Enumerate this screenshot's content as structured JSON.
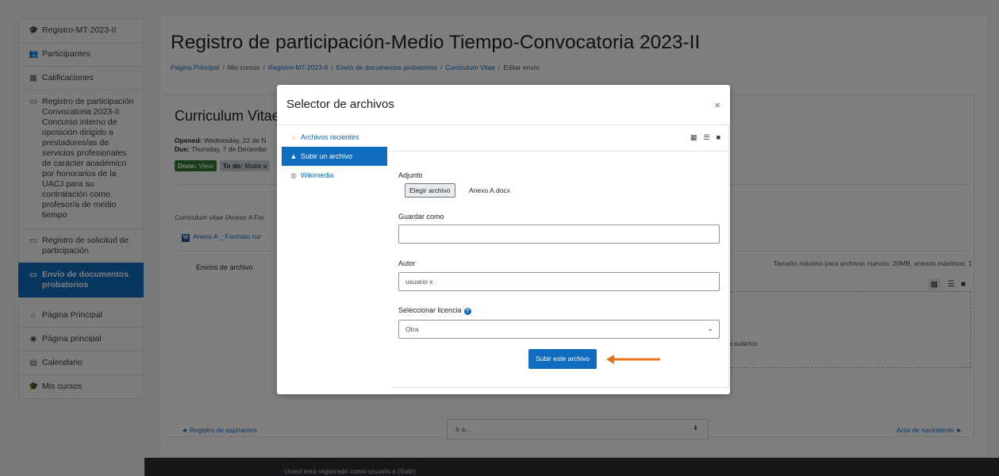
{
  "sidebar": {
    "items": [
      {
        "label": "Registro-MT-2023-II",
        "icon": "graduation-cap-icon"
      },
      {
        "label": "Participantes",
        "icon": "users-icon"
      },
      {
        "label": "Calificaciones",
        "icon": "table-icon"
      },
      {
        "label": "Registro de participación Convocatoria 2023-II Concurso interno de oposición dirigido a prestadores/as de servicios profesionales de carácter académico por honorarios de la UACJ para su contratación como profesor/a de medio tiempo",
        "icon": "folder-icon"
      },
      {
        "label": "Registro de solicitud de participación",
        "icon": "folder-icon"
      },
      {
        "label": "Envío de documentos probatorios",
        "icon": "folder-icon",
        "active": true
      },
      {
        "label": "Página Principal",
        "icon": "home-icon"
      },
      {
        "label": "Página principal",
        "icon": "dashboard-icon"
      },
      {
        "label": "Calendario",
        "icon": "calendar-icon"
      },
      {
        "label": "Mis cursos",
        "icon": "graduation-cap-icon"
      }
    ]
  },
  "header": {
    "title": "Registro de participación-Medio Tiempo-Convocatoria 2023-II",
    "breadcrumb": [
      "Página Principal",
      "Mis cursos",
      "Registro-MT-2023-II",
      "Envío de documentos probatorios",
      "Curriculum Vitae",
      "Editar envío"
    ]
  },
  "assignment": {
    "title": "Curriculum Vitae",
    "opened_label": "Opened:",
    "opened_value": "Wednesday, 22 de N",
    "due_label": "Due:",
    "due_value": "Thursday, 7 de Decembe",
    "done_label": "Done:",
    "done_value": "View",
    "todo_label": "To do:",
    "todo_value": "Make a",
    "intro": "Curriculum vitae (Anexo A For",
    "file_link": "Anexo A _ Formato cur",
    "envios_label": "Envíos de archivo",
    "max_size": "Tamaño máximo para archivos nuevos: 20MB, anexos máximos: 1",
    "drop_text": "a subirlos"
  },
  "navigation": {
    "prev": "◄ Registro de aspirantes",
    "jump_placeholder": "Ir a...",
    "next": "Acta de nacimiento ►"
  },
  "footer": {
    "text": "Usted está registrado como usuario x (Salir)"
  },
  "modal": {
    "title": "Selector de archivos",
    "close": "×",
    "repositories": [
      {
        "label": "Archivos recientes",
        "icon": "recent-files-icon"
      },
      {
        "label": "Subir un archivo",
        "icon": "upload-icon",
        "active": true
      },
      {
        "label": "Wikimedia",
        "icon": "wikimedia-icon"
      }
    ],
    "form": {
      "attachment_label": "Adjunto",
      "choose_file_button": "Elegir archivo",
      "chosen_file": "Anexo A.docx",
      "save_as_label": "Guardar como",
      "save_as_value": "",
      "author_label": "Autor",
      "author_value": "usuario x",
      "license_label": "Seleccionar licencia",
      "license_value": "Otra",
      "upload_button": "Subir este archivo"
    }
  },
  "colors": {
    "primary": "#0f6cbf",
    "done_badge": "#357a32",
    "annotation_arrow": "#e8731a"
  }
}
